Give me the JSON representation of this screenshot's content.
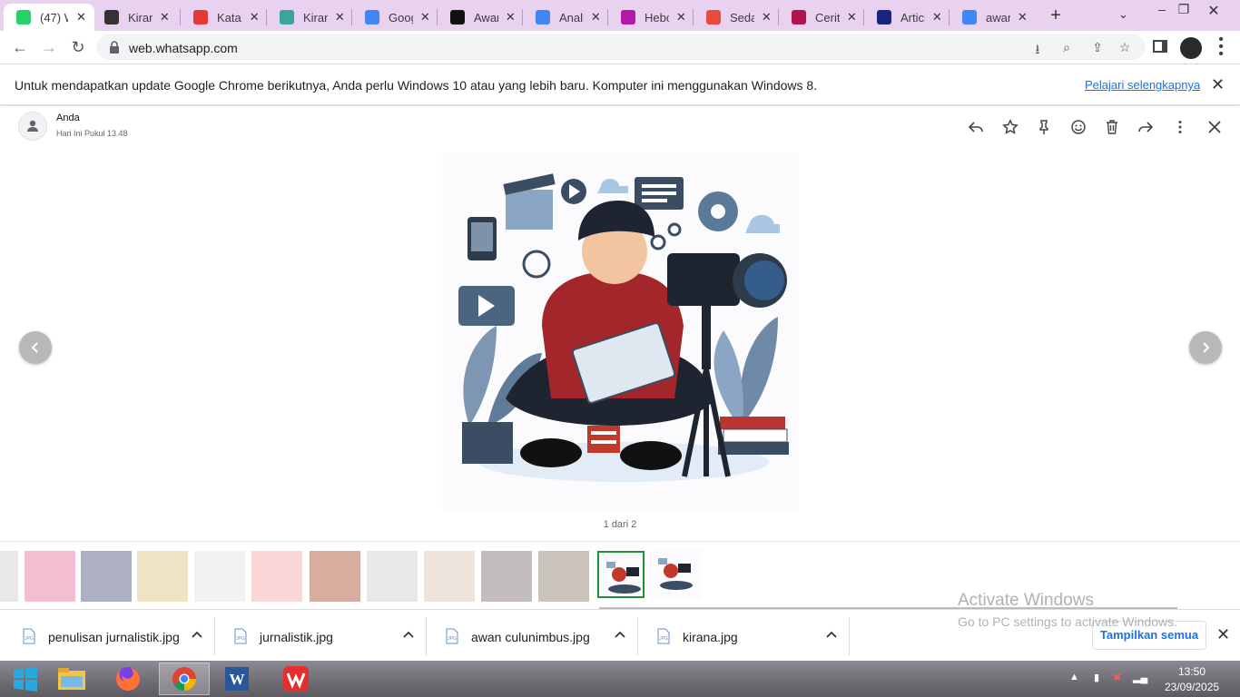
{
  "browser": {
    "tabs": [
      {
        "title": "(47) W",
        "favicon": "whatsapp-icon",
        "color": "#25d366",
        "active": true
      },
      {
        "title": "Kirana",
        "favicon": "openai-icon",
        "color": "#333333"
      },
      {
        "title": "Kata K",
        "favicon": "magnet-icon",
        "color": "#e53935"
      },
      {
        "title": "Kirana",
        "favicon": "quillbot-icon",
        "color": "#3aa4a0"
      },
      {
        "title": "Goog",
        "favicon": "gemini-icon",
        "color": "#4285f4"
      },
      {
        "title": "Awan",
        "favicon": "app-icon",
        "color": "#111111"
      },
      {
        "title": "Analis",
        "favicon": "google-icon",
        "color": "#4285f4"
      },
      {
        "title": "Hebo",
        "favicon": "d-icon",
        "color": "#b31aab"
      },
      {
        "title": "Sedar",
        "favicon": "chart-icon",
        "color": "#e84c3d"
      },
      {
        "title": "Cerita",
        "favicon": "s-icon",
        "color": "#b0164c"
      },
      {
        "title": "Articl",
        "favicon": "ai-icon",
        "color": "#1a237e"
      },
      {
        "title": "awan",
        "favicon": "google-icon",
        "color": "#4285f4"
      }
    ],
    "url": "web.whatsapp.com"
  },
  "infobar": {
    "message": "Untuk mendapatkan update Google Chrome berikutnya, Anda perlu Windows 10 atau yang lebih baru. Komputer ini menggunakan Windows 8.",
    "link": "Pelajari selengkapnya"
  },
  "viewer": {
    "sender": "Anda",
    "time": "Hari Ini Pukul 13.48",
    "counter": "1 dari 2",
    "header_icons": [
      "reply-icon",
      "star-icon",
      "pin-icon",
      "emoji-icon",
      "delete-icon",
      "forward-icon",
      "more-icon",
      "close-icon"
    ]
  },
  "thumbnails": {
    "count": 13,
    "current_index": 10,
    "colors": [
      "#cccccc",
      "#e46f9b",
      "#4a4e7a",
      "#d9c277",
      "#e3e3e3",
      "#f5a3a3",
      "#a44a2a",
      "#cccccc",
      "#d6c6b2",
      "#7a6a6a",
      "#8a7a6a",
      "#ffffff",
      "#ffffff"
    ]
  },
  "downloads": [
    {
      "name": "penulisan jurnalistik.jpg"
    },
    {
      "name": "jurnalistik.jpg"
    },
    {
      "name": "awan culunimbus.jpg"
    },
    {
      "name": "kirana.jpg"
    }
  ],
  "shelf": {
    "show_all": "Tampilkan semua"
  },
  "watermark": {
    "title": "Activate Windows",
    "subtitle": "Go to PC settings to activate Windows."
  },
  "taskbar": {
    "apps": [
      "windows-start-icon",
      "file-explorer-icon",
      "firefox-icon",
      "chrome-icon",
      "word-icon",
      "wps-icon"
    ],
    "time": "13:50",
    "date": "23/09/2025"
  }
}
